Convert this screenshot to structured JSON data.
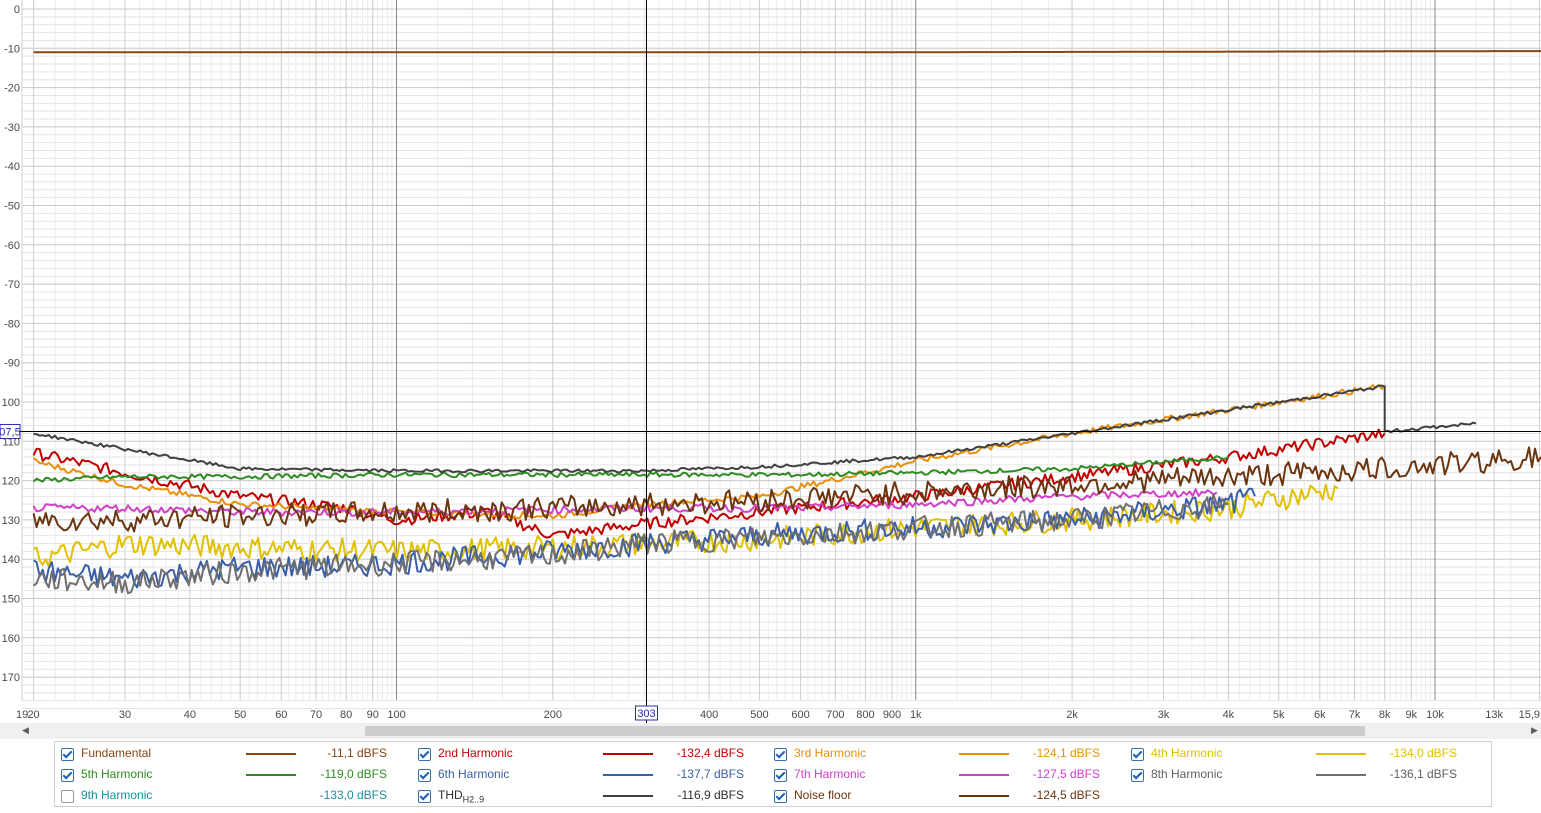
{
  "chart_data": {
    "type": "line",
    "x_scale": "log",
    "xlim": [
      19,
      16000
    ],
    "ylim": [
      0,
      -180
    ],
    "grid": true,
    "x_ticks": [
      {
        "v": 19,
        "label": "19"
      },
      {
        "v": 20,
        "label": "20"
      },
      {
        "v": 30,
        "label": "30"
      },
      {
        "v": 40,
        "label": "40"
      },
      {
        "v": 50,
        "label": "50"
      },
      {
        "v": 60,
        "label": "60"
      },
      {
        "v": 70,
        "label": "70"
      },
      {
        "v": 80,
        "label": "80"
      },
      {
        "v": 90,
        "label": "90"
      },
      {
        "v": 100,
        "label": "100"
      },
      {
        "v": 200,
        "label": "200"
      },
      {
        "v": 400,
        "label": "400"
      },
      {
        "v": 500,
        "label": "500"
      },
      {
        "v": 600,
        "label": "600"
      },
      {
        "v": 700,
        "label": "700"
      },
      {
        "v": 800,
        "label": "800"
      },
      {
        "v": 900,
        "label": "900"
      },
      {
        "v": 1000,
        "label": "1k"
      },
      {
        "v": 2000,
        "label": "2k"
      },
      {
        "v": 3000,
        "label": "3k"
      },
      {
        "v": 4000,
        "label": "4k"
      },
      {
        "v": 5000,
        "label": "5k"
      },
      {
        "v": 6000,
        "label": "6k"
      },
      {
        "v": 7000,
        "label": "7k"
      },
      {
        "v": 8000,
        "label": "8k"
      },
      {
        "v": 9000,
        "label": "9k"
      },
      {
        "v": 10000,
        "label": "10k"
      },
      {
        "v": 13000,
        "label": "13k"
      },
      {
        "v": 15900,
        "label": "15,9"
      }
    ],
    "y_ticks": [
      {
        "v": 0,
        "label": "0"
      },
      {
        "v": -10,
        "label": "-10"
      },
      {
        "v": -20,
        "label": "-20"
      },
      {
        "v": -30,
        "label": "-30"
      },
      {
        "v": -40,
        "label": "-40"
      },
      {
        "v": -50,
        "label": "-50"
      },
      {
        "v": -60,
        "label": "-60"
      },
      {
        "v": -70,
        "label": "-70"
      },
      {
        "v": -80,
        "label": "-80"
      },
      {
        "v": -90,
        "label": "-90"
      },
      {
        "v": -100,
        "label": "100"
      },
      {
        "v": -110,
        "label": "110"
      },
      {
        "v": -120,
        "label": "120"
      },
      {
        "v": -130,
        "label": "130"
      },
      {
        "v": -140,
        "label": "140"
      },
      {
        "v": -150,
        "label": "150"
      },
      {
        "v": -160,
        "label": "160"
      },
      {
        "v": -170,
        "label": "170"
      }
    ],
    "cursor": {
      "x": 303,
      "y": -107.5,
      "x_label": "303",
      "y_label": "07,5"
    },
    "series": [
      {
        "name": "Fundamental",
        "color": "#8B4513",
        "checked": true,
        "readout": "-11,1 dBFS",
        "noise": 0,
        "points": [
          [
            20,
            -11.0
          ],
          [
            1000,
            -11.0
          ],
          [
            16000,
            -10.7
          ]
        ]
      },
      {
        "name": "2nd Harmonic",
        "color": "#c00000",
        "checked": true,
        "readout": "-132,4 dBFS",
        "noise": 1.5,
        "points": [
          [
            20,
            -113
          ],
          [
            30,
            -118
          ],
          [
            50,
            -124
          ],
          [
            80,
            -127
          ],
          [
            100,
            -130
          ],
          [
            150,
            -128
          ],
          [
            200,
            -134
          ],
          [
            300,
            -131
          ],
          [
            500,
            -128
          ],
          [
            1000,
            -124
          ],
          [
            2000,
            -119
          ],
          [
            4000,
            -114
          ],
          [
            8000,
            -108
          ]
        ]
      },
      {
        "name": "3rd Harmonic",
        "color": "#e8900c",
        "checked": true,
        "readout": "-124,1 dBFS",
        "noise": 0.8,
        "points": [
          [
            20,
            -115
          ],
          [
            30,
            -121
          ],
          [
            50,
            -126
          ],
          [
            100,
            -128
          ],
          [
            200,
            -129
          ],
          [
            300,
            -126
          ],
          [
            500,
            -124
          ],
          [
            1000,
            -115
          ],
          [
            2000,
            -108
          ],
          [
            8000,
            -96
          ]
        ]
      },
      {
        "name": "4th Harmonic",
        "color": "#e0c000",
        "checked": true,
        "readout": "-134,0 dBFS",
        "noise": 3,
        "points": [
          [
            20,
            -140
          ],
          [
            30,
            -136
          ],
          [
            50,
            -137
          ],
          [
            100,
            -138
          ],
          [
            200,
            -137
          ],
          [
            300,
            -136
          ],
          [
            500,
            -135
          ],
          [
            1000,
            -132
          ],
          [
            2000,
            -130
          ],
          [
            4000,
            -127
          ],
          [
            6500,
            -122
          ]
        ]
      },
      {
        "name": "5th Harmonic",
        "color": "#2e8b22",
        "checked": true,
        "readout": "-119,0 dBFS",
        "noise": 0.6,
        "points": [
          [
            20,
            -120
          ],
          [
            30,
            -119
          ],
          [
            50,
            -119
          ],
          [
            100,
            -118.5
          ],
          [
            300,
            -118.5
          ],
          [
            600,
            -118.5
          ],
          [
            1000,
            -118
          ],
          [
            2000,
            -117
          ],
          [
            4000,
            -114
          ]
        ]
      },
      {
        "name": "6th Harmonic",
        "color": "#3a5fa8",
        "checked": true,
        "readout": "-137,7 dBFS",
        "noise": 3,
        "points": [
          [
            20,
            -143
          ],
          [
            30,
            -145
          ],
          [
            50,
            -142
          ],
          [
            80,
            -142
          ],
          [
            100,
            -141
          ],
          [
            200,
            -138
          ],
          [
            300,
            -136
          ],
          [
            500,
            -134
          ],
          [
            1000,
            -132
          ],
          [
            2000,
            -130
          ],
          [
            4000,
            -126
          ],
          [
            4500,
            -124
          ]
        ]
      },
      {
        "name": "7th Harmonic",
        "color": "#d040c8",
        "checked": true,
        "readout": "-127,5 dBFS",
        "noise": 1,
        "points": [
          [
            20,
            -127
          ],
          [
            30,
            -127
          ],
          [
            50,
            -128
          ],
          [
            100,
            -128
          ],
          [
            300,
            -127
          ],
          [
            600,
            -127
          ],
          [
            1000,
            -126
          ],
          [
            2000,
            -124
          ],
          [
            3800,
            -123
          ]
        ]
      },
      {
        "name": "8th Harmonic",
        "color": "#707070",
        "checked": true,
        "readout": "-136,1 dBFS",
        "noise": 3,
        "points": [
          [
            20,
            -145
          ],
          [
            30,
            -146
          ],
          [
            50,
            -143
          ],
          [
            100,
            -141
          ],
          [
            200,
            -139
          ],
          [
            300,
            -136
          ],
          [
            600,
            -134
          ],
          [
            1000,
            -132
          ],
          [
            2000,
            -130
          ],
          [
            4000,
            -126
          ]
        ]
      },
      {
        "name": "9th Harmonic",
        "color": "#1a8fa0",
        "checked": false,
        "readout": "-133,0 dBFS",
        "noise": 0,
        "points": []
      },
      {
        "name": "THD",
        "color": "#404040",
        "checked": true,
        "readout": "-116,9 dBFS",
        "noise": 0.4,
        "points": [
          [
            20,
            -108
          ],
          [
            30,
            -112
          ],
          [
            50,
            -117
          ],
          [
            100,
            -117.5
          ],
          [
            300,
            -117.5
          ],
          [
            500,
            -116.5
          ],
          [
            1000,
            -114
          ],
          [
            2000,
            -108
          ],
          [
            8000,
            -96
          ],
          [
            8000,
            -107.5
          ],
          [
            12000,
            -105.5
          ]
        ]
      },
      {
        "name": "Noise floor",
        "color": "#6b3510",
        "checked": true,
        "readout": "-124,5 dBFS",
        "noise": 3,
        "points": [
          [
            20,
            -130
          ],
          [
            30,
            -130
          ],
          [
            50,
            -129
          ],
          [
            100,
            -128
          ],
          [
            200,
            -127
          ],
          [
            300,
            -126
          ],
          [
            500,
            -125
          ],
          [
            1000,
            -123
          ],
          [
            2000,
            -121
          ],
          [
            4000,
            -119
          ],
          [
            8000,
            -117
          ],
          [
            16000,
            -114
          ]
        ]
      }
    ]
  },
  "legend": {
    "items": [
      {
        "name": "Fundamental",
        "sub": "",
        "value": "-11,1 dBFS",
        "checked": true,
        "text_color": "#8B4513",
        "line_color": "#8B4513",
        "value_color": "#8B4513"
      },
      {
        "name": "2nd Harmonic",
        "sub": "",
        "value": "-132,4 dBFS",
        "checked": true,
        "text_color": "#c00000",
        "line_color": "#c00000",
        "value_color": "#c00000"
      },
      {
        "name": "3rd Harmonic",
        "sub": "",
        "value": "-124,1 dBFS",
        "checked": true,
        "text_color": "#e8900c",
        "line_color": "#e8900c",
        "value_color": "#e8900c"
      },
      {
        "name": "4th Harmonic",
        "sub": "",
        "value": "-134,0 dBFS",
        "checked": true,
        "text_color": "#e0c000",
        "line_color": "#e0c000",
        "value_color": "#e0c000"
      },
      {
        "name": "5th Harmonic",
        "sub": "",
        "value": "-119,0 dBFS",
        "checked": true,
        "text_color": "#2e8b22",
        "line_color": "#2e8b22",
        "value_color": "#2e8b22"
      },
      {
        "name": "6th Harmonic",
        "sub": "",
        "value": "-137,7 dBFS",
        "checked": true,
        "text_color": "#3a5fa8",
        "line_color": "#3a5fa8",
        "value_color": "#3a5fa8"
      },
      {
        "name": "7th Harmonic",
        "sub": "",
        "value": "-127,5 dBFS",
        "checked": true,
        "text_color": "#d040c8",
        "line_color": "#d040c8",
        "value_color": "#d040c8"
      },
      {
        "name": "8th Harmonic",
        "sub": "",
        "value": "-136,1 dBFS",
        "checked": true,
        "text_color": "#606060",
        "line_color": "#707070",
        "value_color": "#606060"
      },
      {
        "name": "9th Harmonic",
        "sub": "",
        "value": "-133,0 dBFS",
        "checked": false,
        "text_color": "#1a8fa0",
        "line_color": "",
        "value_color": "#1a8fa0"
      },
      {
        "name": "THD",
        "sub": "H2..9",
        "value": "-116,9 dBFS",
        "checked": true,
        "text_color": "#303030",
        "line_color": "#404040",
        "value_color": "#303030"
      },
      {
        "name": "Noise floor",
        "sub": "",
        "value": "-124,5 dBFS",
        "checked": true,
        "text_color": "#6b3510",
        "line_color": "#6b3510",
        "value_color": "#6b3510"
      }
    ]
  }
}
